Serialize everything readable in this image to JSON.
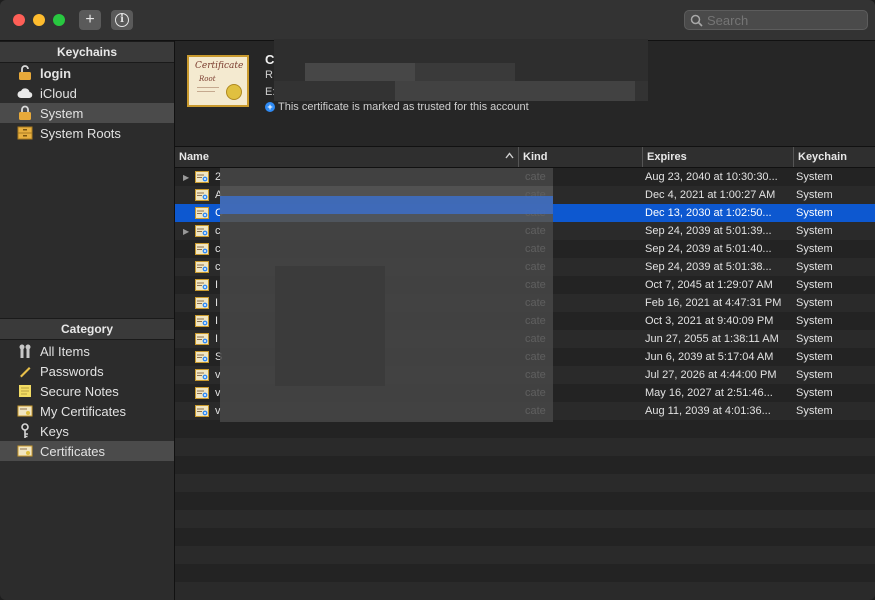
{
  "window": {
    "search_placeholder": "Search",
    "add_button_glyph": "+",
    "info_button_glyph": "i"
  },
  "sidebar": {
    "keychains_header": "Keychains",
    "keychains": [
      {
        "label": "login",
        "icon": "lock-open-icon"
      },
      {
        "label": "iCloud",
        "icon": "cloud-icon"
      },
      {
        "label": "System",
        "icon": "lock-icon",
        "selected": true
      },
      {
        "label": "System Roots",
        "icon": "cabinet-icon"
      }
    ],
    "category_header": "Category",
    "categories": [
      {
        "label": "All Items",
        "icon": "all-items-icon"
      },
      {
        "label": "Passwords",
        "icon": "pencil-icon"
      },
      {
        "label": "Secure Notes",
        "icon": "note-icon"
      },
      {
        "label": "My Certificates",
        "icon": "my-certificates-icon"
      },
      {
        "label": "Keys",
        "icon": "key-icon"
      },
      {
        "label": "Certificates",
        "icon": "certificate-icon",
        "selected": true
      }
    ]
  },
  "info": {
    "title_initial": "C",
    "line2_initial": "R",
    "line3_initial": "E:",
    "trust_text": "This certificate is marked as trusted for this account",
    "thumbnail_text_1": "Certificate",
    "thumbnail_text_2": "Root"
  },
  "table": {
    "columns": {
      "name": "Name",
      "kind": "Kind",
      "expires": "Expires",
      "keychain": "Keychain"
    },
    "rows": [
      {
        "name": "2",
        "kind": "cate",
        "expires": "Aug 23, 2040 at 10:30:30...",
        "keychain": "System",
        "expandable": true
      },
      {
        "name": "A",
        "kind": "cate",
        "expires": "Dec 4, 2021 at 1:00:27 AM",
        "keychain": "System"
      },
      {
        "name": "C",
        "kind": "cate",
        "expires": "Dec 13, 2030 at 1:02:50...",
        "keychain": "System",
        "selected": true
      },
      {
        "name": "c",
        "kind": "cate",
        "expires": "Sep 24, 2039 at 5:01:39...",
        "keychain": "System",
        "expandable": true
      },
      {
        "name": "c",
        "kind": "cate",
        "expires": "Sep 24, 2039 at 5:01:40...",
        "keychain": "System"
      },
      {
        "name": "c",
        "kind": "cate",
        "expires": "Sep 24, 2039 at 5:01:38...",
        "keychain": "System"
      },
      {
        "name": "I",
        "kind": "cate",
        "expires": "Oct 7, 2045 at 1:29:07 AM",
        "keychain": "System"
      },
      {
        "name": "I",
        "kind": "cate",
        "expires": "Feb 16, 2021 at 4:47:31 PM",
        "keychain": "System"
      },
      {
        "name": "I",
        "kind": "cate",
        "expires": "Oct 3, 2021 at 9:40:09 PM",
        "keychain": "System"
      },
      {
        "name": "I",
        "kind": "cate",
        "expires": "Jun 27, 2055 at 1:38:11 AM",
        "keychain": "System"
      },
      {
        "name": "S",
        "kind": "cate",
        "expires": "Jun 6, 2039 at 5:17:04 AM",
        "keychain": "System"
      },
      {
        "name": "v",
        "kind": "cate",
        "expires": "Jul 27, 2026 at 4:44:00 PM",
        "keychain": "System"
      },
      {
        "name": "v",
        "kind": "cate",
        "expires": "May 16, 2027 at 2:51:46...",
        "keychain": "System"
      },
      {
        "name": "v",
        "kind": "cate",
        "expires": "Aug 11, 2039 at 4:01:36...",
        "keychain": "System"
      }
    ]
  },
  "colors": {
    "selection_blue": "#0d58d0",
    "sidebar_selected": "#4b4b4b",
    "trust_blue": "#2f8bf5"
  }
}
